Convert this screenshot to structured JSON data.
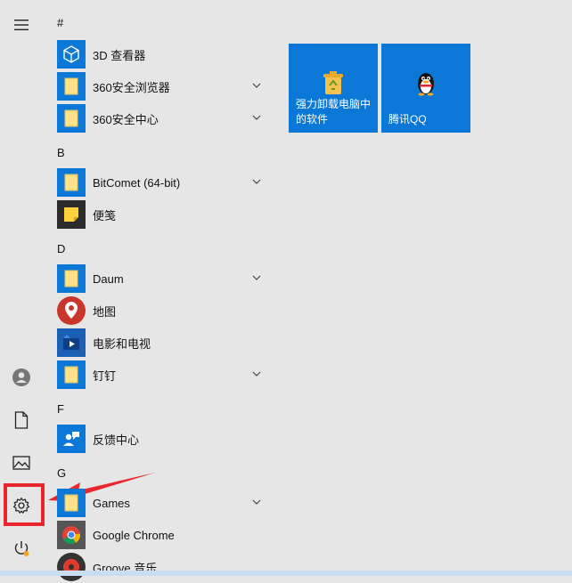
{
  "sections": {
    "hash": "#",
    "b": "B",
    "d": "D",
    "f": "F",
    "g": "G"
  },
  "apps": [
    {
      "label": "3D 查看器"
    },
    {
      "label": "360安全浏览器"
    },
    {
      "label": "360安全中心"
    },
    {
      "label": "BitComet (64-bit)"
    },
    {
      "label": "便笺"
    },
    {
      "label": "Daum"
    },
    {
      "label": "地图"
    },
    {
      "label": "电影和电视"
    },
    {
      "label": "钉钉"
    },
    {
      "label": "反馈中心"
    },
    {
      "label": "Games"
    },
    {
      "label": "Google Chrome"
    },
    {
      "label": "Groove 音乐"
    }
  ],
  "tiles": [
    {
      "label": "强力卸载电脑中的软件"
    },
    {
      "label": "腾讯QQ"
    }
  ],
  "colors": {
    "accent": "#0b78d7",
    "annotation": "#e8262b",
    "background": "#e6e6e6"
  },
  "icons": {
    "menu": "hamburger-icon",
    "user": "user-avatar-icon",
    "documents": "document-icon",
    "pictures": "pictures-icon",
    "settings": "gear-icon",
    "power": "power-icon"
  }
}
